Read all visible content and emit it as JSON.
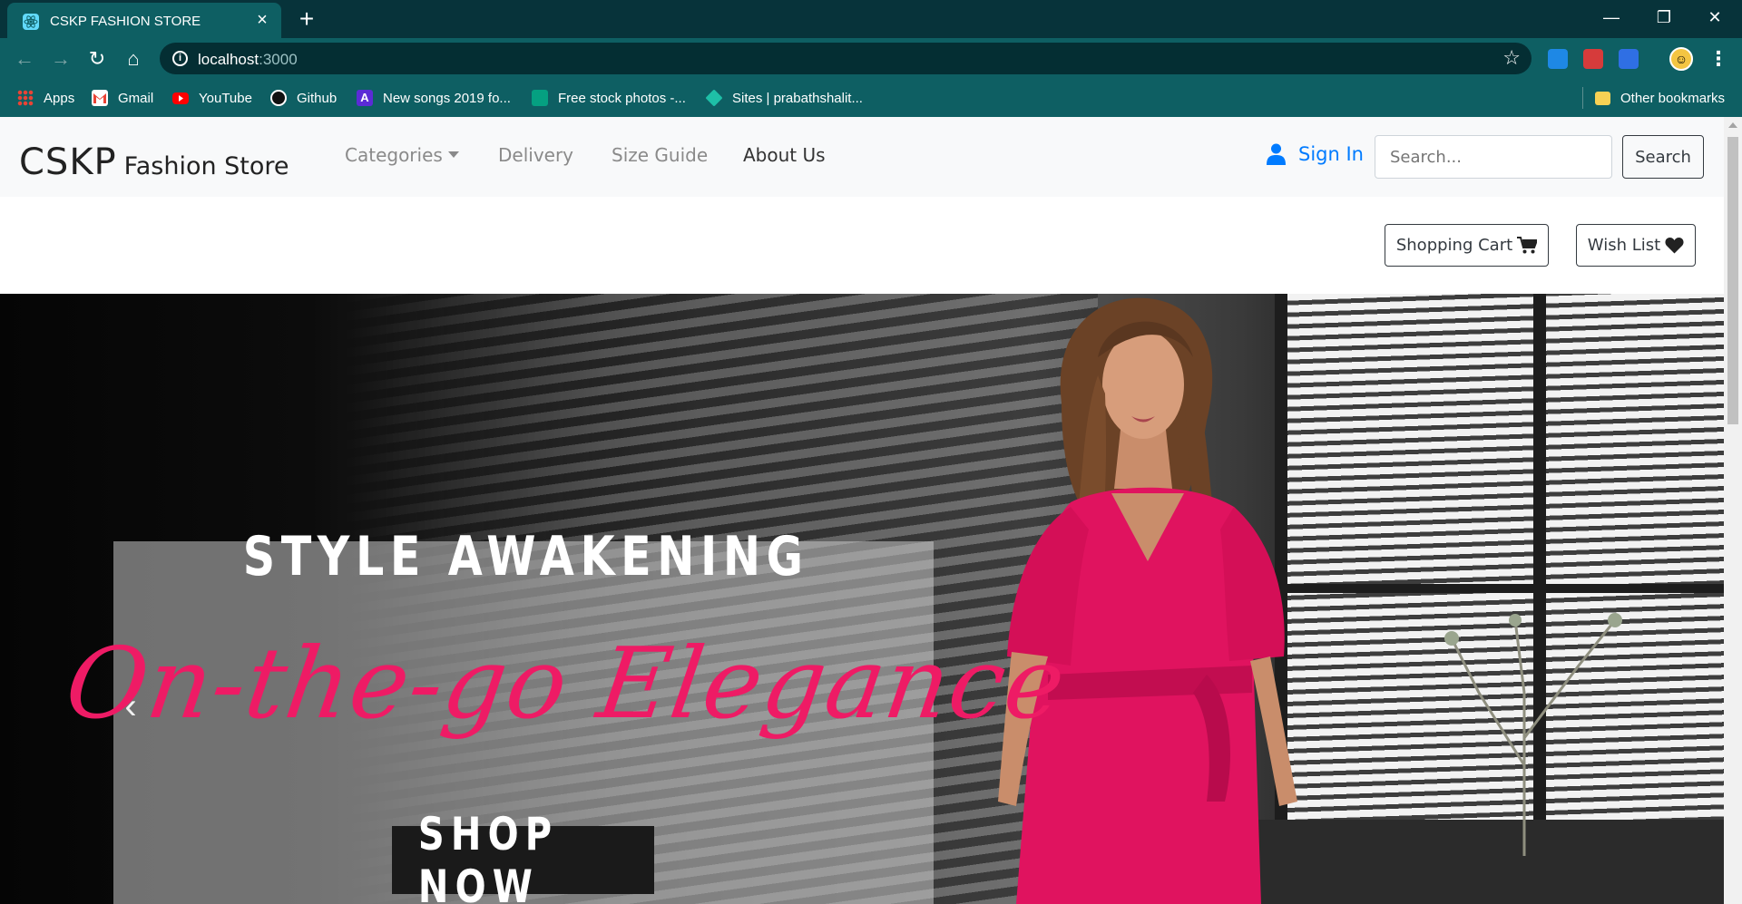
{
  "browser": {
    "tab_title": "CSKP FASHION STORE",
    "url_host": "localhost",
    "url_port": ":3000",
    "bookmarks": [
      {
        "label": "Apps",
        "icon": "apps-grid-icon"
      },
      {
        "label": "Gmail",
        "icon": "gmail-icon"
      },
      {
        "label": "YouTube",
        "icon": "youtube-icon"
      },
      {
        "label": "Github",
        "icon": "github-icon"
      },
      {
        "label": "New songs 2019 fo...",
        "icon": "songs-icon"
      },
      {
        "label": "Free stock photos -...",
        "icon": "stock-photos-icon"
      },
      {
        "label": "Sites | prabathshalit...",
        "icon": "sites-icon"
      }
    ],
    "other_bookmarks": "Other bookmarks"
  },
  "navbar": {
    "brand_main": "CSKP",
    "brand_sub": "Fashion Store",
    "links": [
      {
        "label": "Categories",
        "dropdown": true
      },
      {
        "label": "Delivery"
      },
      {
        "label": "Size Guide"
      },
      {
        "label": "About Us",
        "active": true
      }
    ],
    "signin_label": "Sign In",
    "search_placeholder": "Search...",
    "search_button": "Search"
  },
  "actions": {
    "cart_label": "Shopping Cart",
    "wishlist_label": "Wish List"
  },
  "hero": {
    "kicker": "STYLE AWAKENING",
    "script": "On-the-go Elegance",
    "cta": "SHOP NOW",
    "prev_glyph": "‹"
  },
  "colors": {
    "chrome_dark": "#07333a",
    "chrome": "#0e5f63",
    "link_blue": "#007bff",
    "accent_pink": "#ee1b65",
    "dress": "#e0135f"
  }
}
